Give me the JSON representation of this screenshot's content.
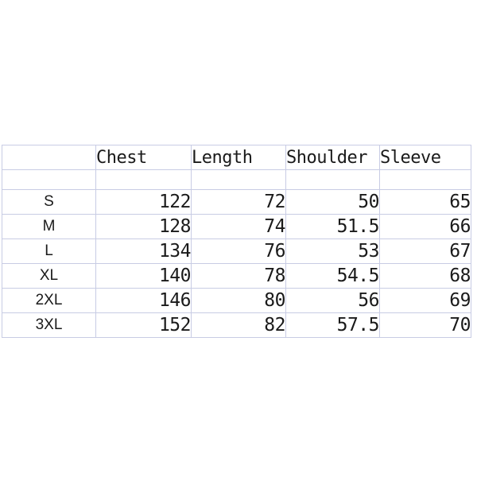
{
  "table": {
    "corner_label": "",
    "columns": [
      {
        "key": "chest",
        "label": "Chest"
      },
      {
        "key": "length",
        "label": "Length"
      },
      {
        "key": "shoulder",
        "label": "Shoulder"
      },
      {
        "key": "sleeve",
        "label": "Sleeve"
      }
    ],
    "spacer_row": {
      "size": "",
      "chest": "",
      "length": "",
      "shoulder": "",
      "sleeve": ""
    },
    "rows": [
      {
        "size": "S",
        "chest": "122",
        "length": "72",
        "shoulder": "50",
        "sleeve": "65"
      },
      {
        "size": "M",
        "chest": "128",
        "length": "74",
        "shoulder": "51.5",
        "sleeve": "66"
      },
      {
        "size": "L",
        "chest": "134",
        "length": "76",
        "shoulder": "53",
        "sleeve": "67"
      },
      {
        "size": "XL",
        "chest": "140",
        "length": "78",
        "shoulder": "54.5",
        "sleeve": "68"
      },
      {
        "size": "2XL",
        "chest": "146",
        "length": "80",
        "shoulder": "56",
        "sleeve": "69"
      },
      {
        "size": "3XL",
        "chest": "152",
        "length": "82",
        "shoulder": "57.5",
        "sleeve": "70"
      }
    ]
  },
  "colors": {
    "grid_line": "#c8cce4",
    "text": "#1a1a1a",
    "background": "#ffffff"
  }
}
